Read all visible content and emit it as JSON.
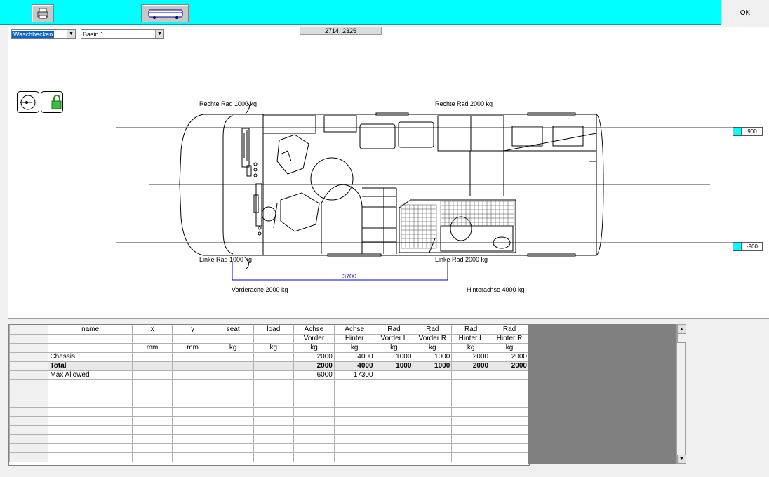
{
  "toolbar": {
    "ok_label": "OK"
  },
  "selectors": {
    "component": "Waschbecken",
    "item": "Basin 1"
  },
  "status": {
    "coords": "2714, 2325"
  },
  "floorplan": {
    "labels": {
      "right_front": "Rechte Rad  1000 kg",
      "right_rear": "Rechte Rad  2000 kg",
      "left_front": "Linke Rad  1000 kg",
      "left_rear": "Linke Rad  2000 kg",
      "wheelbase": "3700",
      "front_axle": "Vorderache  2000 kg",
      "rear_axle": "Hinterachse  4000 kg"
    },
    "offsets": {
      "top": "900",
      "bottom": "-900"
    }
  },
  "colors": {
    "toolbar": "#00ffff",
    "dimension": "#0000cc",
    "divider": "#cc0000",
    "grid_filler": "#808080"
  },
  "table": {
    "header_rows": [
      [
        "name",
        "x",
        "y",
        "seat",
        "load",
        "Achse",
        "Achse",
        "Rad",
        "Rad",
        "Rad",
        "Rad"
      ],
      [
        "",
        "",
        "",
        "",
        "",
        "Vorder",
        "Hinter",
        "Vorder L",
        "Vorder R",
        "Hinter L",
        "Hinter R"
      ],
      [
        "",
        "mm",
        "mm",
        "kg",
        "kg",
        "kg",
        "kg",
        "kg",
        "kg",
        "kg",
        "kg"
      ]
    ],
    "rows": [
      [
        "Chassis:",
        "",
        "",
        "",
        "",
        "2000",
        "4000",
        "1000",
        "1000",
        "2000",
        "2000"
      ],
      [
        "Total",
        "",
        "",
        "",
        "",
        "2000",
        "4000",
        "1000",
        "1000",
        "2000",
        "2000"
      ],
      [
        "Max Allowed",
        "",
        "",
        "",
        "",
        "6000",
        "17300",
        "",
        "",
        "",
        ""
      ]
    ],
    "empty_rows": 9
  }
}
